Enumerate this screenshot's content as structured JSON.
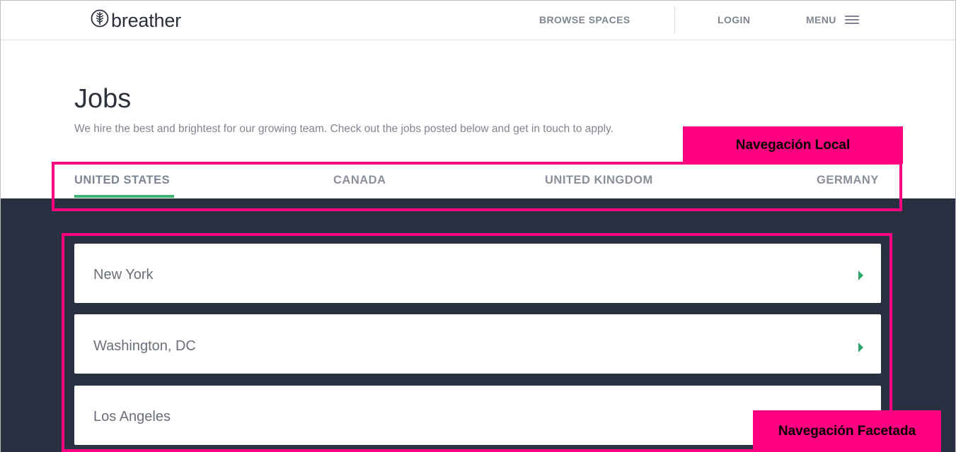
{
  "header": {
    "logo_text": "breather",
    "logo_icon": "tree-leaf-icon",
    "nav": {
      "browse": "BROWSE SPACES",
      "login": "LOGIN",
      "menu": "MENU"
    }
  },
  "hero": {
    "title": "Jobs",
    "subtitle": "We hire the best and brightest for our growing team. Check out the jobs posted below and get in touch to apply."
  },
  "tabs": [
    {
      "label": "UNITED STATES",
      "active": true
    },
    {
      "label": "CANADA",
      "active": false
    },
    {
      "label": "UNITED KINGDOM",
      "active": false
    },
    {
      "label": "GERMANY",
      "active": false
    }
  ],
  "cities": [
    {
      "name": "New York"
    },
    {
      "name": "Washington, DC"
    },
    {
      "name": "Los Angeles"
    }
  ],
  "annotations": {
    "local": "Navegación Local",
    "faceted": "Navegación Facetada"
  },
  "colors": {
    "accent_green": "#3cb371",
    "dark_bg": "#283042",
    "annotation_pink": "#ff0080"
  }
}
